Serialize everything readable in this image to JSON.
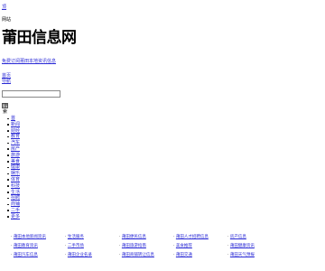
{
  "topbar": {
    "label": "顶"
  },
  "header": {
    "tagline": "网站",
    "logo_text": "莆田信息网",
    "subscribe_link": "免费订阅莆田本地资讯信息"
  },
  "nav": {
    "links": [
      "首页",
      "  导航"
    ]
  },
  "search": {
    "value": "",
    "button_label": "搜索"
  },
  "categories": [
    "首",
    "新闻",
    "财经",
    "教育",
    "汽车",
    "房产",
    "旅游",
    "美食",
    "健康",
    "娱乐",
    "体育",
    "科技",
    "生活",
    "招聘",
    "商铺",
    "二手",
    "更多"
  ],
  "link_grid": {
    "rows": [
      [
        "莆田本地新闻资讯",
        "生活服务",
        "莆田便民信息",
        "莆田人才招聘信息",
        "房产信息"
      ],
      [
        "莆田教育资讯",
        "二手市场",
        "莆田旅游指南",
        "美食推荐",
        "莆田健康资讯"
      ],
      [
        "莆田汽车信息",
        "莆田企业名录",
        "莆田商铺转让信息",
        "莆田交通",
        "莆田天气预报"
      ]
    ]
  }
}
